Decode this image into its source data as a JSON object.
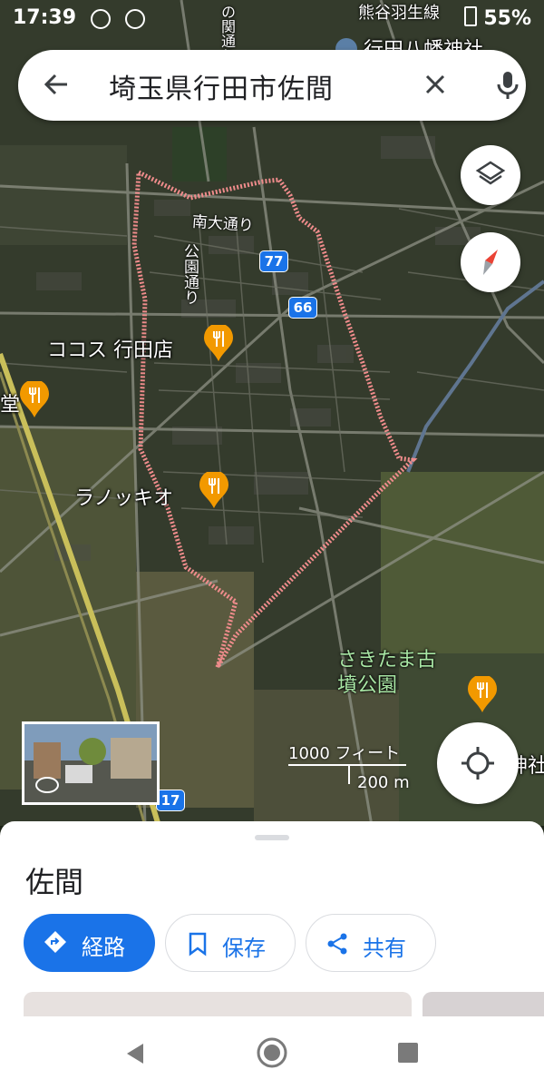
{
  "status": {
    "time": "17:39",
    "battery": "55%"
  },
  "search": {
    "query": "埼玉県行田市佐間"
  },
  "map": {
    "top_label": "行田八幡神社",
    "top_partial": "熊谷羽生線",
    "road_label_vertical": "の関通り",
    "labels": {
      "minami_odori": "南大通り",
      "koen_dori": "公園通り",
      "cocos": "ココス 行田店",
      "do_partial": "堂",
      "ranokkio": "ラノッキオ",
      "sakitama": "さきたま古墳公園",
      "jinja_partial": "神社"
    },
    "shields": [
      "77",
      "66",
      "17"
    ],
    "scale": {
      "imperial": "1000 フィート",
      "metric": "200 m"
    }
  },
  "place": {
    "title": "佐間",
    "actions": [
      {
        "label": "経路",
        "icon": "directions-icon"
      },
      {
        "label": "保存",
        "icon": "bookmark-icon"
      },
      {
        "label": "共有",
        "icon": "share-icon"
      }
    ]
  },
  "colors": {
    "accent": "#1a73e8",
    "boundary": "#f08c8c"
  }
}
